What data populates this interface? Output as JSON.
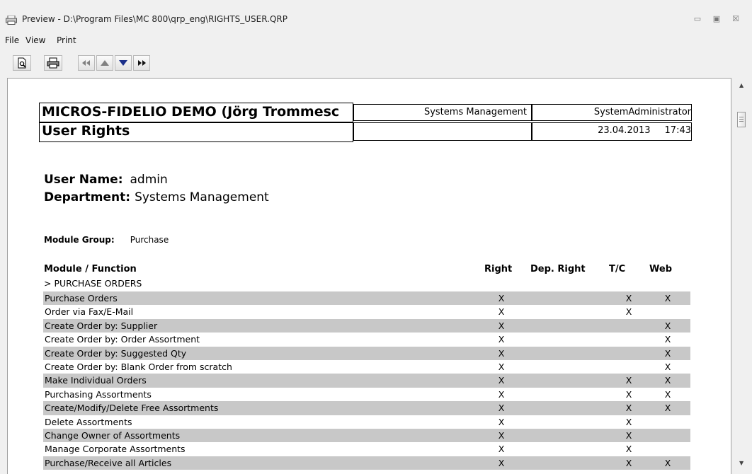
{
  "window": {
    "title": "Preview - D:\\Program Files\\MC 800\\qrp_eng\\RIGHTS_USER.QRP",
    "controls": [
      "▭",
      "▣",
      "☒"
    ]
  },
  "menu": [
    {
      "label": "File"
    },
    {
      "label": "View"
    },
    {
      "label": "Print"
    }
  ],
  "toolbar": {
    "buttons": [
      "page-preview-icon",
      "printer-icon",
      "first-page-icon",
      "previous-page-icon",
      "next-page-icon",
      "last-page-icon"
    ]
  },
  "report": {
    "company": "MICROS-FIDELIO DEMO (Jörg Trommesc",
    "title": "User Rights",
    "department_header": "Systems Management",
    "user_header": "SystemAdministrator",
    "date": "23.04.2013",
    "time": "17:43",
    "user_name_label": "User Name:",
    "user_name": "admin",
    "department_label": "Department:",
    "department": "Systems Management",
    "module_group_label": "Module Group:",
    "module_group": "Purchase",
    "columns": {
      "function": "Module / Function",
      "right": "Right",
      "dep_right": "Dep. Right",
      "tc": "T/C",
      "web": "Web"
    },
    "section": "> PURCHASE ORDERS",
    "rows": [
      {
        "fn": "Purchase Orders",
        "right": "X",
        "dep": "",
        "tc": "X",
        "web": "X"
      },
      {
        "fn": "Order via Fax/E-Mail",
        "right": "X",
        "dep": "",
        "tc": "X",
        "web": ""
      },
      {
        "fn": "Create Order by: Supplier",
        "right": "X",
        "dep": "",
        "tc": "",
        "web": "X"
      },
      {
        "fn": "Create Order by: Order Assortment",
        "right": "X",
        "dep": "",
        "tc": "",
        "web": "X"
      },
      {
        "fn": "Create Order by: Suggested Qty",
        "right": "X",
        "dep": "",
        "tc": "",
        "web": "X"
      },
      {
        "fn": "Create Order by: Blank Order from scratch",
        "right": "X",
        "dep": "",
        "tc": "",
        "web": "X"
      },
      {
        "fn": "Make Individual Orders",
        "right": "X",
        "dep": "",
        "tc": "X",
        "web": "X"
      },
      {
        "fn": "Purchasing Assortments",
        "right": "X",
        "dep": "",
        "tc": "X",
        "web": "X"
      },
      {
        "fn": "Create/Modify/Delete Free Assortments",
        "right": "X",
        "dep": "",
        "tc": "X",
        "web": "X"
      },
      {
        "fn": "Delete Assortments",
        "right": "X",
        "dep": "",
        "tc": "X",
        "web": ""
      },
      {
        "fn": "Change Owner of Assortments",
        "right": "X",
        "dep": "",
        "tc": "X",
        "web": ""
      },
      {
        "fn": "Manage Corporate Assortments",
        "right": "X",
        "dep": "",
        "tc": "X",
        "web": ""
      },
      {
        "fn": "Purchase/Receive all Articles",
        "right": "X",
        "dep": "",
        "tc": "X",
        "web": "X"
      }
    ]
  },
  "colors": {
    "row_shade": "#c8c8c8",
    "nav_arrow": "#1a2f8a"
  }
}
